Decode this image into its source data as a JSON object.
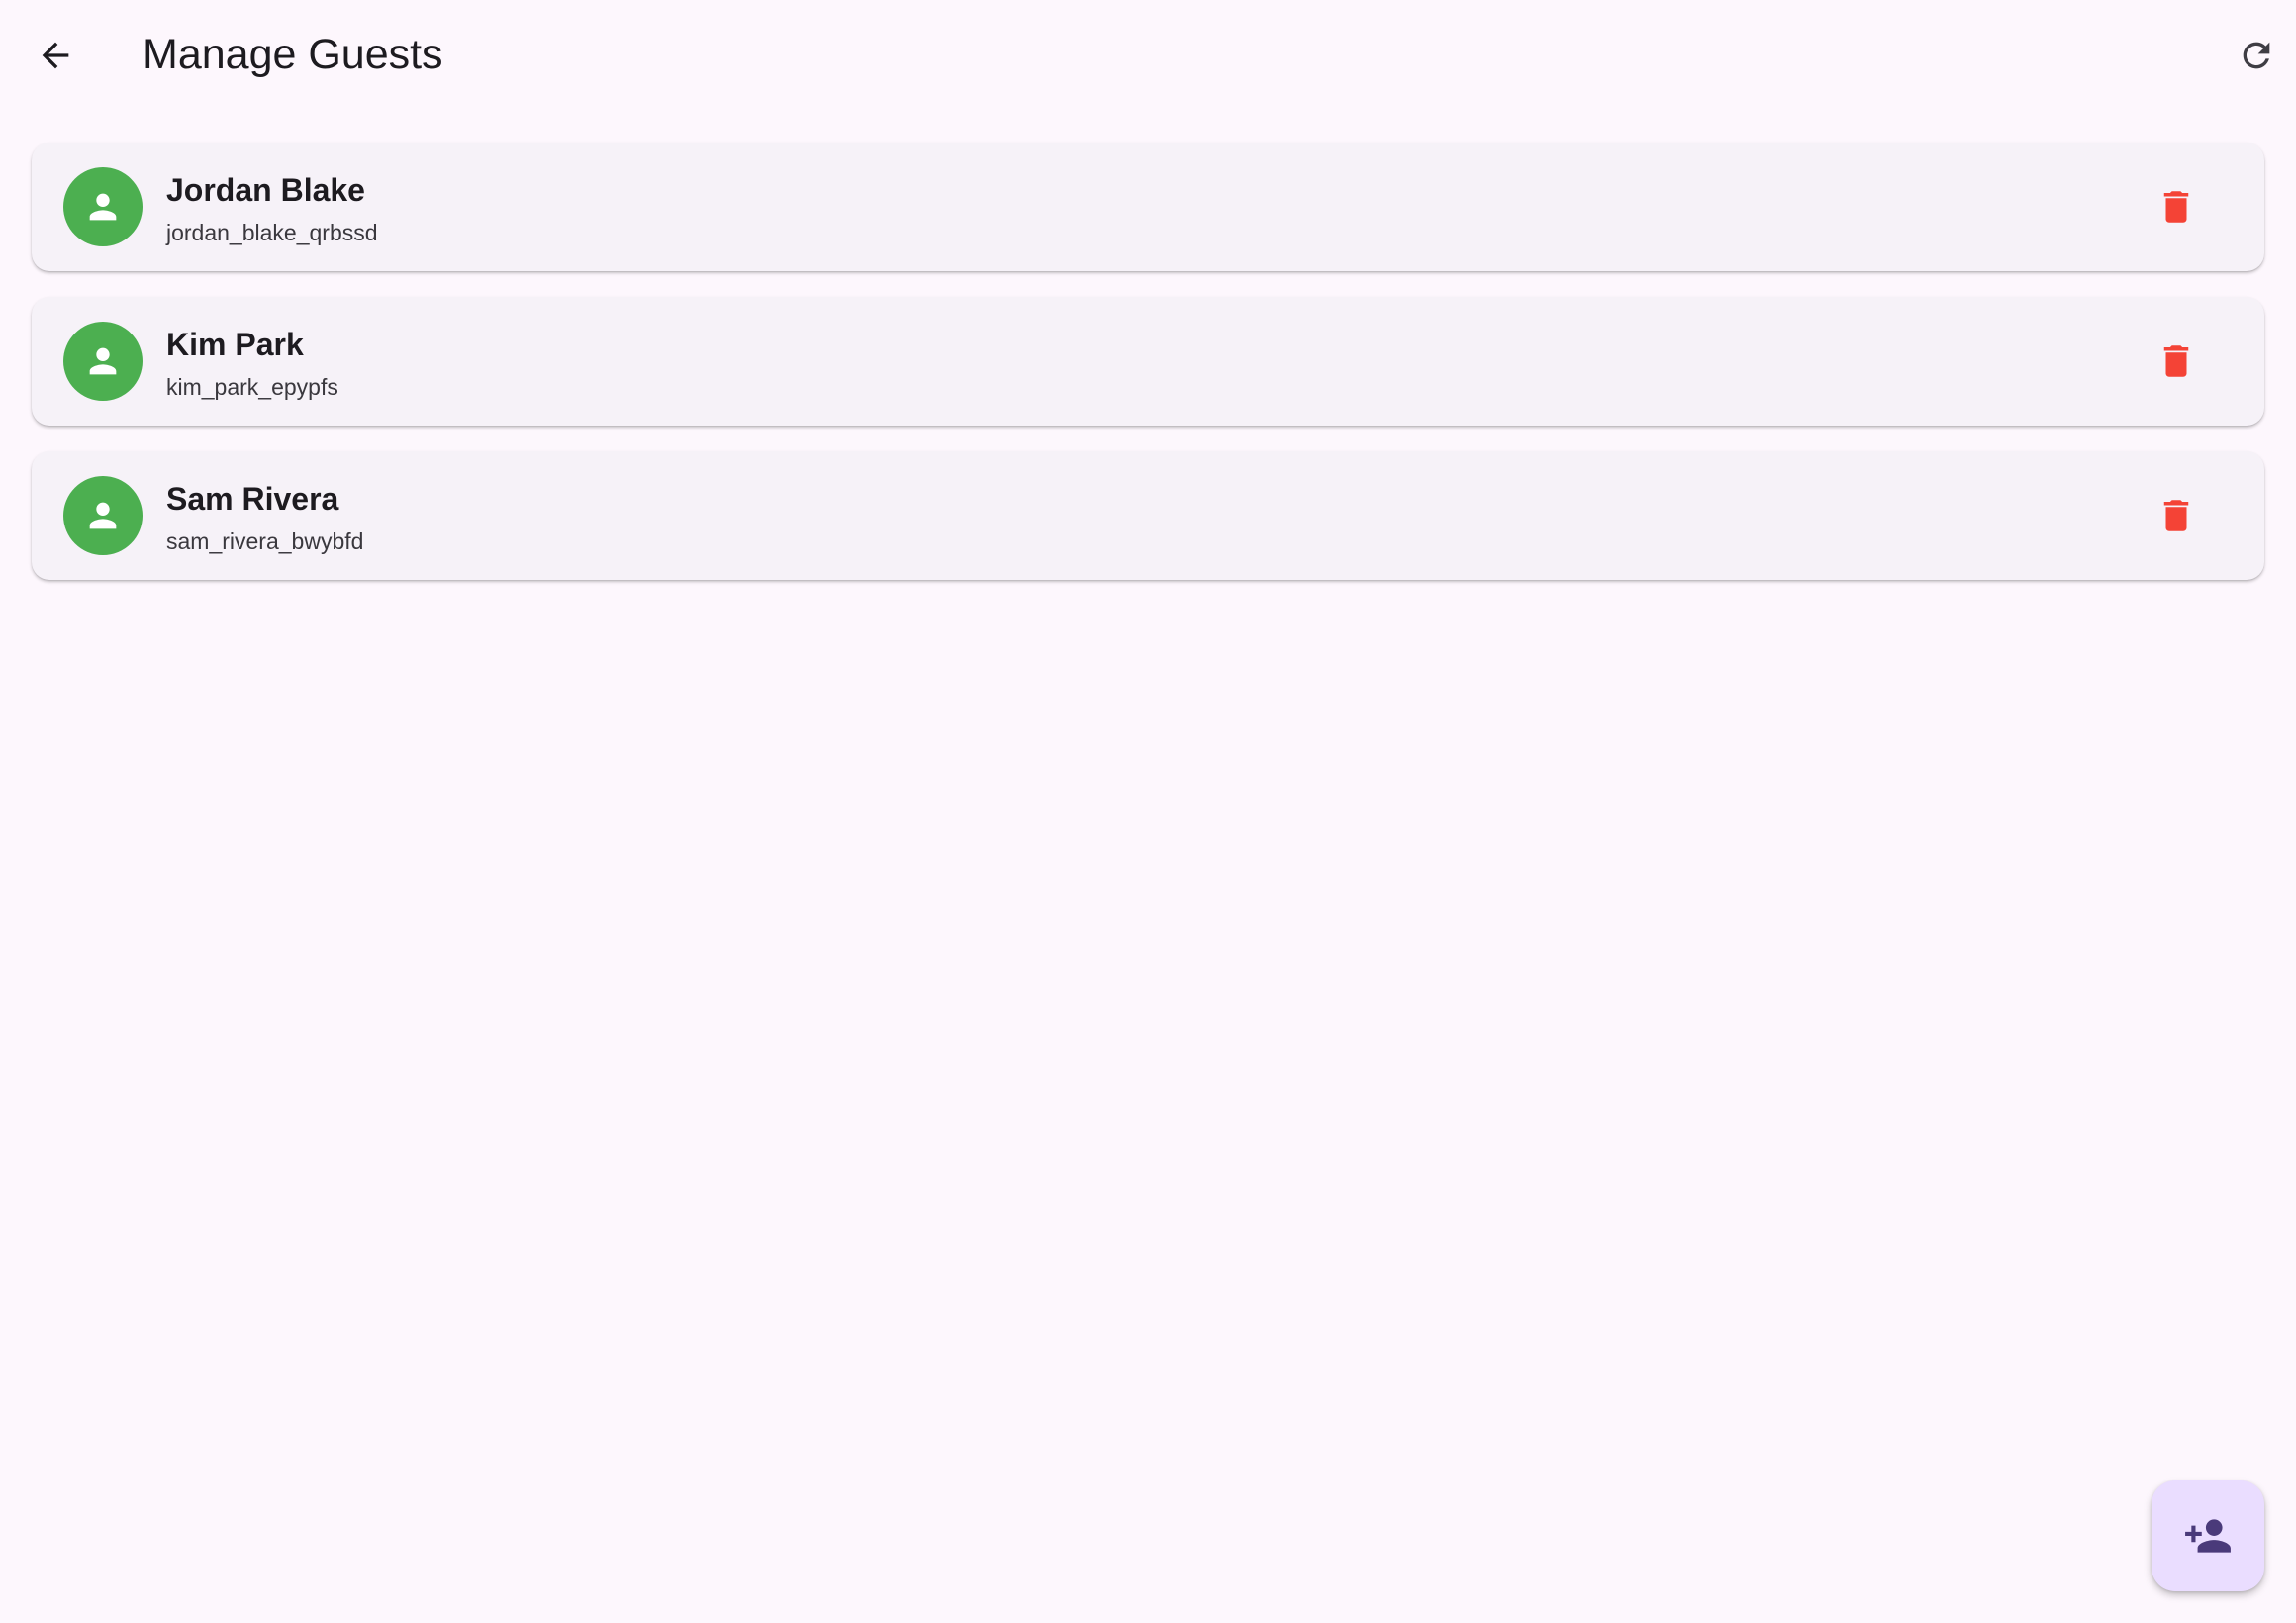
{
  "app_bar": {
    "title": "Manage Guests",
    "back_icon": "arrow-back-icon",
    "refresh_icon": "refresh-icon"
  },
  "guests": [
    {
      "name": "Jordan Blake",
      "username": "jordan_blake_qrbssd"
    },
    {
      "name": "Kim Park",
      "username": "kim_park_epypfs"
    },
    {
      "name": "Sam Rivera",
      "username": "sam_rivera_bwybfd"
    }
  ],
  "guest_item": {
    "avatar_icon": "person-icon",
    "delete_icon": "delete-icon"
  },
  "fab": {
    "icon": "person-add-icon"
  },
  "colors": {
    "background": "#fdf7fd",
    "card": "#f6f2f8",
    "avatar": "#4caf50",
    "delete": "#f44336",
    "fab": "#eaddff",
    "fab_icon": "#4a3a7a"
  }
}
